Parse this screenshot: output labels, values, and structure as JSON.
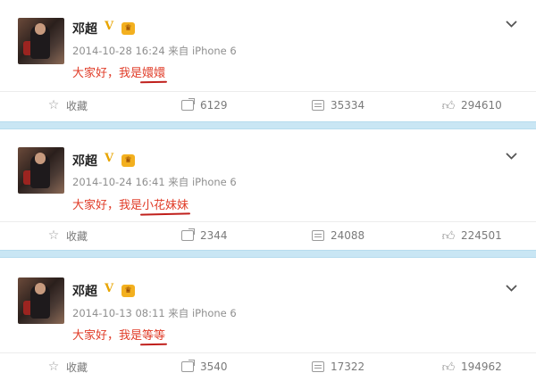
{
  "posts": [
    {
      "author": "邓超",
      "meta": "2014-10-28 16:24 来自 iPhone 6",
      "content_prefix": "大家好，我是",
      "content_highlight": "嬛嬛",
      "actions": {
        "collect": "收藏",
        "forward": "6129",
        "comment": "35334",
        "like": "294610"
      }
    },
    {
      "author": "邓超",
      "meta": "2014-10-24 16:41 来自 iPhone 6",
      "content_prefix": "大家好，我是",
      "content_highlight": "小花妹妹",
      "actions": {
        "collect": "收藏",
        "forward": "2344",
        "comment": "24088",
        "like": "224501"
      }
    },
    {
      "author": "邓超",
      "meta": "2014-10-13 08:11 来自 iPhone 6",
      "content_prefix": "大家好，我是",
      "content_highlight": "等等",
      "actions": {
        "collect": "收藏",
        "forward": "3540",
        "comment": "17322",
        "like": "194962"
      }
    }
  ],
  "icons": {
    "verified": "V",
    "crown": "♛",
    "chevron": "chevron-down-icon",
    "collect": "star-icon",
    "forward": "forward-icon",
    "comment": "comment-icon",
    "like": "thumbs-up-icon"
  },
  "colors": {
    "accent_red": "#e03c28",
    "separator": "#c9e6f4",
    "verified_gold": "#e8a500"
  }
}
